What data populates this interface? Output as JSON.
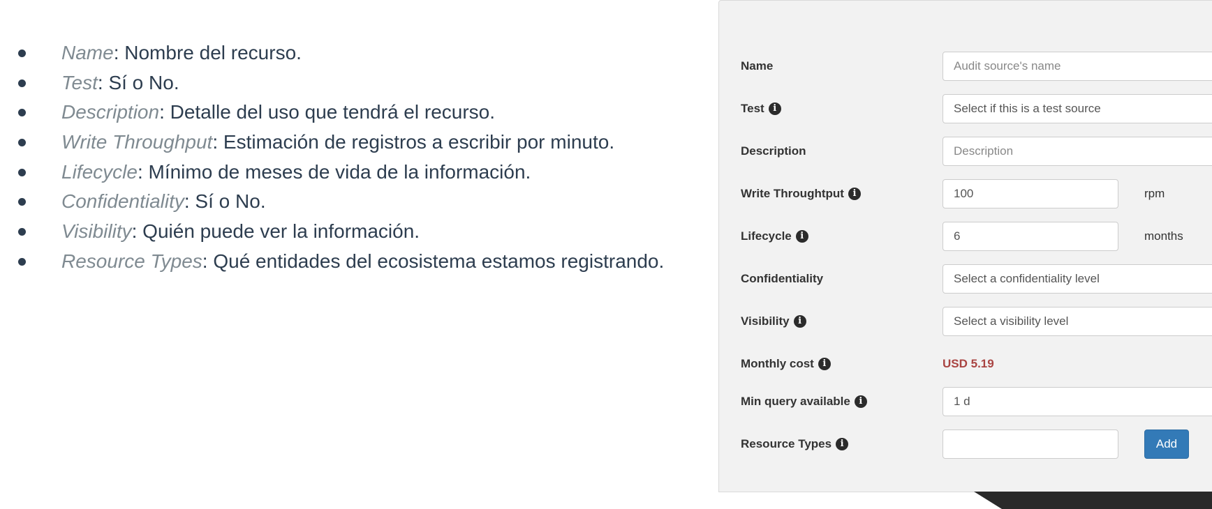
{
  "doc_list": [
    {
      "term": "Name",
      "desc": ": Nombre del recurso."
    },
    {
      "term": "Test",
      "desc": ": Sí o No."
    },
    {
      "term": "Description",
      "desc": ": Detalle del uso que tendrá el recurso."
    },
    {
      "term": "Write Throughput",
      "desc": ": Estimación de registros a escribir por minuto."
    },
    {
      "term": "Lifecycle",
      "desc": ": Mínimo de meses de vida de la información."
    },
    {
      "term": "Confidentiality",
      "desc": ": Sí o No."
    },
    {
      "term": "Visibility",
      "desc": ": Quién puede ver la información."
    },
    {
      "term": "Resource Types",
      "desc": ": Qué entidades del ecosistema estamos registrando."
    }
  ],
  "form": {
    "name": {
      "label": "Name",
      "placeholder": "Audit source's name"
    },
    "test": {
      "label": "Test",
      "placeholder": "Select if this is a test source"
    },
    "description": {
      "label": "Description",
      "placeholder": "Description"
    },
    "write_throughput": {
      "label": "Write Throughtput",
      "value": "100",
      "unit": "rpm"
    },
    "lifecycle": {
      "label": "Lifecycle",
      "value": "6",
      "unit": "months"
    },
    "confidentiality": {
      "label": "Confidentiality",
      "placeholder": "Select a confidentiality level"
    },
    "visibility": {
      "label": "Visibility",
      "placeholder": "Select a visibility level"
    },
    "monthly_cost": {
      "label": "Monthly cost",
      "value": "USD 5.19"
    },
    "min_query": {
      "label": "Min query available",
      "value": "1 d"
    },
    "resource_types": {
      "label": "Resource Types",
      "value": "",
      "add_label": "Add"
    }
  },
  "colors": {
    "panel_bg": "#f2f2f2",
    "cost": "#a94442",
    "primary_button": "#337ab7",
    "list_text": "#2d3d4f",
    "list_term": "#7f8a91"
  },
  "icons": {
    "info": "info-circle-icon",
    "bullet": "bullet-dot"
  }
}
